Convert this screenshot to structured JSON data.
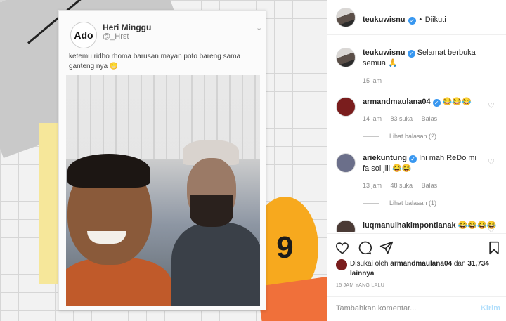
{
  "tweet": {
    "avatar_text": "Ado",
    "name": "Heri Minggu",
    "handle": "@_Hrst",
    "text": "ketemu ridho rhoma barusan mayan poto bareng sama ganteng nya 😬",
    "sticker_text": "9"
  },
  "header": {
    "username": "teukuwisnu",
    "separator": "•",
    "follow_status": "Diikuti",
    "more_icon": "more-horizontal-icon"
  },
  "caption": {
    "username": "teukuwisnu",
    "text": "Selamat berbuka semua 🙏",
    "time": "15 jam"
  },
  "comments": [
    {
      "username": "armandmaulana04",
      "verified": true,
      "text": "😂😂😂",
      "time": "14 jam",
      "likes": "83 suka",
      "reply": "Balas",
      "replies": "Lihat balasan (2)"
    },
    {
      "username": "ariekuntung",
      "verified": true,
      "text": "Ini mah ReDo mi fa sol jiii 😂😂",
      "time": "13 jam",
      "likes": "48 suka",
      "reply": "Balas",
      "replies": "Lihat balasan (1)"
    },
    {
      "username": "luqmanulhakimpontianak",
      "verified": false,
      "text": "😂😂😂😂"
    }
  ],
  "likes": {
    "prefix": "Disukai oleh",
    "user": "armandmaulana04",
    "connector": "dan",
    "count": "31,734 lainnya"
  },
  "time_ago": "15 JAM YANG LALU",
  "add_comment": {
    "placeholder": "Tambahkan komentar...",
    "post_label": "Kirim"
  },
  "colors": {
    "verified": "#3897f0",
    "link": "#262626",
    "post_disabled": "#b2dffc"
  }
}
